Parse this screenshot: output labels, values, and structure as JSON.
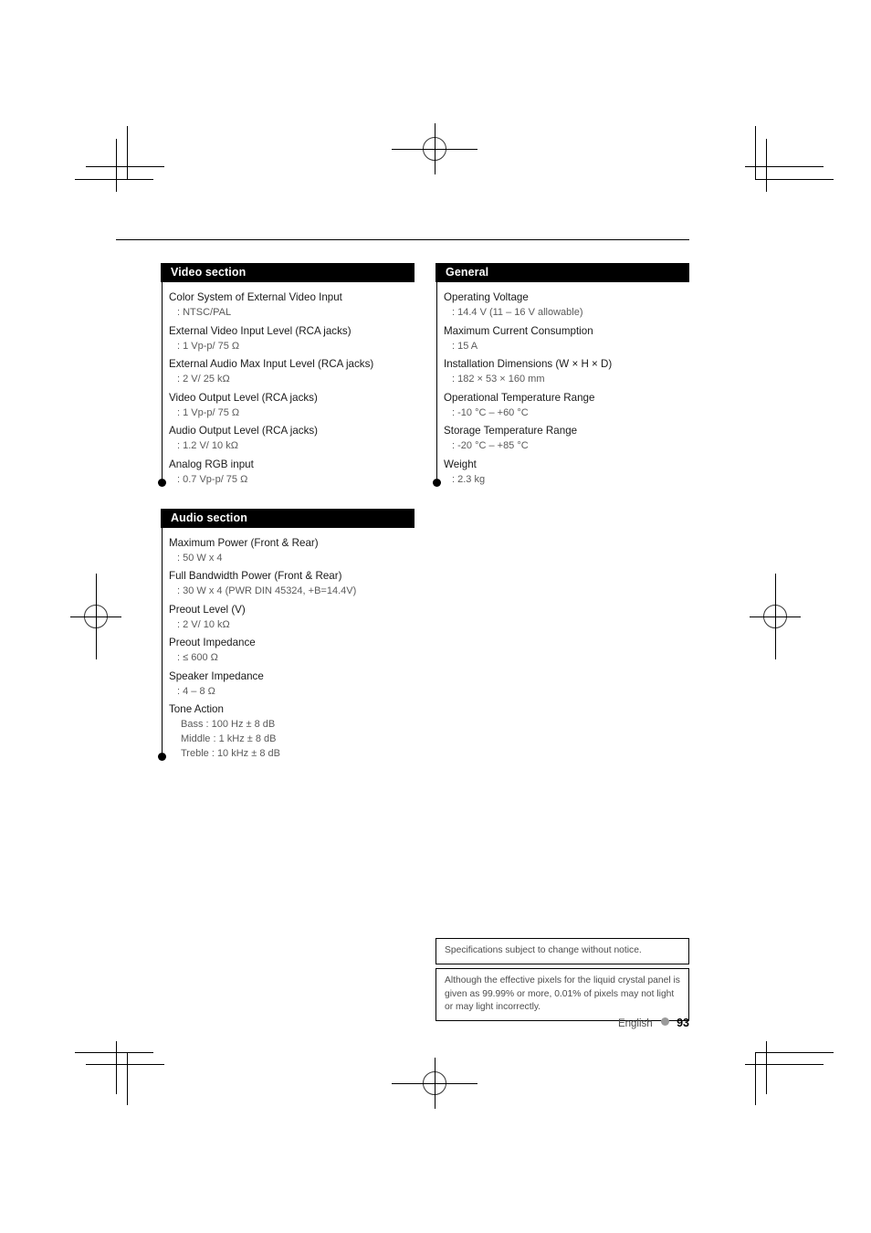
{
  "page": {
    "language": "English",
    "number": "93"
  },
  "sections": {
    "video": {
      "title": "Video section",
      "items": [
        {
          "name": "Color System of External Video Input",
          "value": ": NTSC/PAL"
        },
        {
          "name": "External Video Input Level (RCA jacks)",
          "value": ": 1 Vp-p/ 75 Ω"
        },
        {
          "name": "External Audio Max Input Level (RCA jacks)",
          "value": ": 2 V/ 25 kΩ"
        },
        {
          "name": "Video Output Level (RCA jacks)",
          "value": ": 1 Vp-p/ 75 Ω"
        },
        {
          "name": "Audio Output Level (RCA jacks)",
          "value": ": 1.2 V/ 10 kΩ"
        },
        {
          "name": "Analog RGB input",
          "value": ": 0.7 Vp-p/ 75 Ω"
        }
      ]
    },
    "audio": {
      "title": "Audio section",
      "items": [
        {
          "name": "Maximum Power (Front & Rear)",
          "value": ": 50 W x 4"
        },
        {
          "name": "Full Bandwidth Power (Front & Rear)",
          "value": ": 30 W x 4 (PWR DIN 45324, +B=14.4V)"
        },
        {
          "name": "Preout Level (V)",
          "value": ": 2 V/ 10 kΩ"
        },
        {
          "name": "Preout Impedance",
          "value": ": ≤ 600 Ω"
        },
        {
          "name": "Speaker Impedance",
          "value": ": 4 – 8 Ω"
        },
        {
          "name": "Tone Action",
          "subvalues": [
            "Bass : 100 Hz ± 8 dB",
            "Middle : 1 kHz ± 8 dB",
            "Treble : 10 kHz ± 8 dB"
          ]
        }
      ]
    },
    "general": {
      "title": "General",
      "items": [
        {
          "name": "Operating Voltage",
          "value": ": 14.4 V (11 – 16 V allowable)"
        },
        {
          "name": "Maximum Current Consumption",
          "value": ": 15 A"
        },
        {
          "name": "Installation Dimensions  (W × H × D)",
          "value": ": 182 × 53 × 160 mm"
        },
        {
          "name": "Operational Temperature Range",
          "value": ": -10 °C – +60 °C"
        },
        {
          "name": "Storage Temperature Range",
          "value": ": -20 °C – +85 °C"
        },
        {
          "name": "Weight",
          "value": ": 2.3 kg"
        }
      ]
    }
  },
  "notes": {
    "note1": "Specifications subject to change without notice.",
    "note2": "Although the effective pixels for the liquid crystal panel is given as 99.99% or more, 0.01% of pixels may not light or may light incorrectly."
  }
}
